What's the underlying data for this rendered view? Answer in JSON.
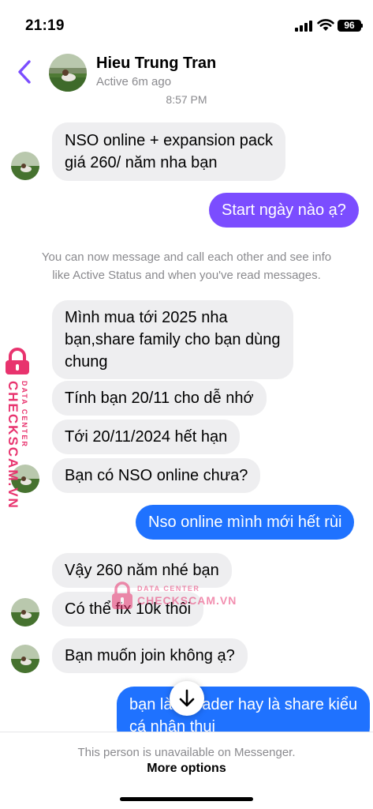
{
  "status_bar": {
    "time": "21:19",
    "battery": "96"
  },
  "header": {
    "name": "Hieu Trung Tran",
    "status": "Active 6m ago",
    "timestamp": "8:57 PM"
  },
  "messages": [
    {
      "from": "contact",
      "lines": [
        "NSO online + expansion pack",
        "giá 260/ năm nha bạn"
      ]
    },
    {
      "from": "me",
      "lines": [
        "Start ngày nào ạ?"
      ]
    },
    {
      "from": "contact",
      "lines": [
        "Mình mua tới 2025 nha",
        "bạn,share family cho bạn dùng",
        "chung"
      ]
    },
    {
      "from": "contact",
      "lines": [
        "Tính bạn 20/11 cho dễ nhớ"
      ]
    },
    {
      "from": "contact",
      "lines": [
        "Tới 20/11/2024 hết hạn"
      ]
    },
    {
      "from": "contact",
      "lines": [
        "Bạn có NSO online chưa?"
      ]
    },
    {
      "from": "me",
      "lines": [
        "Nso online mình mới hết rùi"
      ]
    },
    {
      "from": "contact",
      "lines": [
        "Vậy 260 năm nhé bạn"
      ]
    },
    {
      "from": "contact",
      "lines": [
        "Có thể fix 10k thôi"
      ]
    },
    {
      "from": "contact",
      "lines": [
        "Bạn muốn join không ạ?"
      ]
    },
    {
      "from": "me",
      "lines": [
        "bạn làm leader hay là share kiểu",
        "cá nhân thui"
      ]
    }
  ],
  "info_notice": [
    "You can now message and call each other and see info",
    "like Active Status and when you've read messages."
  ],
  "watermark": {
    "line1": "DATA CENTER",
    "line2": "CHECKSCAM.VN"
  },
  "footer": {
    "notice": "This person is unavailable on Messenger.",
    "more_options": "More options"
  },
  "colors": {
    "accent_purple": "#7b4dff",
    "accent_blue": "#1f72ff",
    "incoming_bubble": "#eeeef0",
    "watermark": "#e8336e"
  },
  "icons": [
    "back-chevron-icon",
    "signal-icon",
    "wifi-icon",
    "battery-icon",
    "arrow-down-icon",
    "lock-icon"
  ]
}
